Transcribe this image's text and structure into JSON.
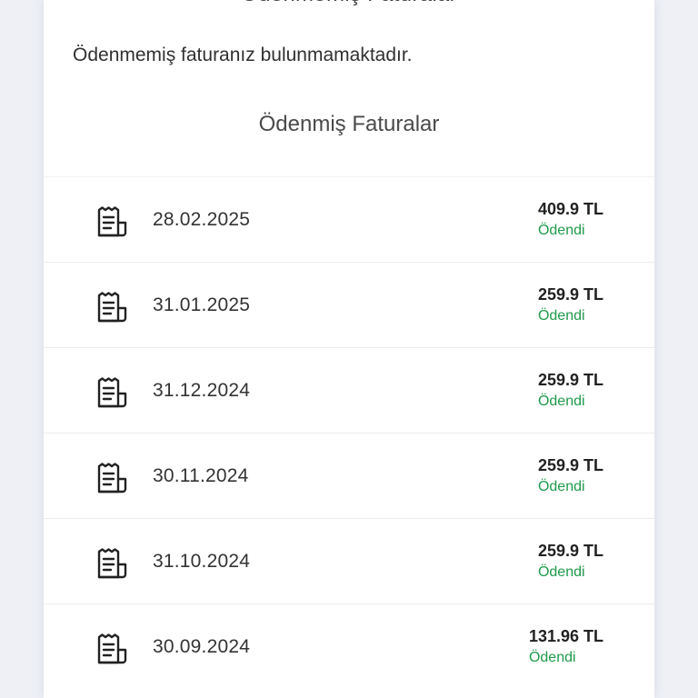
{
  "header": {
    "cut_title": "Ödenmemiş Faturalar"
  },
  "notice": "Ödenmemiş faturanız bulunmamaktadır.",
  "paid_section": {
    "title": "Ödenmiş Faturalar"
  },
  "invoices": [
    {
      "date": "28.02.2025",
      "amount": "409.9 TL",
      "status": "Ödendi",
      "icon": "receipt-icon"
    },
    {
      "date": "31.01.2025",
      "amount": "259.9 TL",
      "status": "Ödendi",
      "icon": "receipt-icon"
    },
    {
      "date": "31.12.2024",
      "amount": "259.9 TL",
      "status": "Ödendi",
      "icon": "receipt-icon"
    },
    {
      "date": "30.11.2024",
      "amount": "259.9 TL",
      "status": "Ödendi",
      "icon": "receipt-icon"
    },
    {
      "date": "31.10.2024",
      "amount": "259.9 TL",
      "status": "Ödendi",
      "icon": "receipt-icon"
    },
    {
      "date": "30.09.2024",
      "amount": "131.96 TL",
      "status": "Ödendi",
      "icon": "receipt-icon"
    }
  ],
  "colors": {
    "status_paid": "#1e9a4a",
    "background": "#eef0f6",
    "card": "#ffffff"
  }
}
